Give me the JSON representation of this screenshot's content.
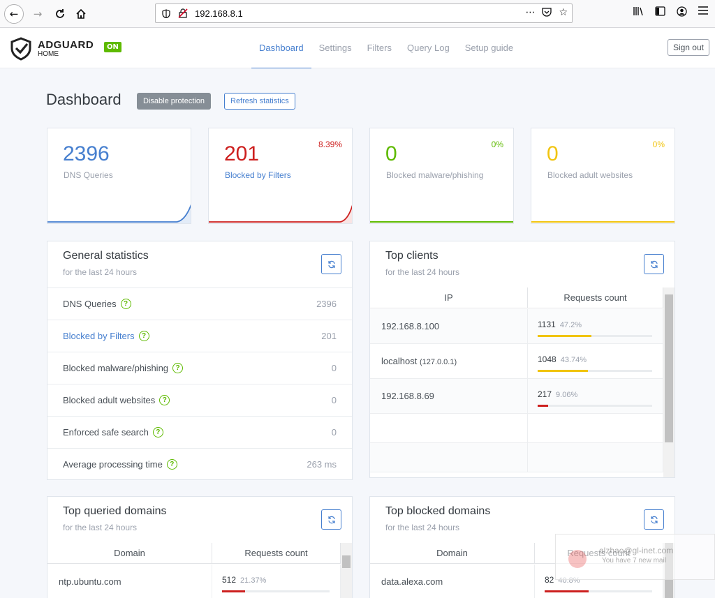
{
  "browser": {
    "url": "192.168.8.1",
    "more_icon": "⋯"
  },
  "app": {
    "logo_name": "ADGUARD",
    "logo_sub": "HOME",
    "status_badge": "ON",
    "tabs": [
      {
        "label": "Dashboard",
        "active": true
      },
      {
        "label": "Settings",
        "active": false
      },
      {
        "label": "Filters",
        "active": false
      },
      {
        "label": "Query Log",
        "active": false
      },
      {
        "label": "Setup guide",
        "active": false
      }
    ],
    "signout_label": "Sign out"
  },
  "dashboard": {
    "title": "Dashboard",
    "disable_label": "Disable protection",
    "refresh_label": "Refresh statistics"
  },
  "stat_cards": [
    {
      "value": "2396",
      "label": "DNS Queries",
      "percent": "",
      "color": "#467fcf"
    },
    {
      "value": "201",
      "label": "Blocked by Filters",
      "percent": "8.39%",
      "color": "#cd201f"
    },
    {
      "value": "0",
      "label": "Blocked malware/phishing",
      "percent": "0%",
      "color": "#5eba00"
    },
    {
      "value": "0",
      "label": "Blocked adult websites",
      "percent": "0%",
      "color": "#f1c40f"
    }
  ],
  "general_stats": {
    "title": "General statistics",
    "subtitle": "for the last 24 hours",
    "rows": [
      {
        "label": "DNS Queries",
        "value": "2396"
      },
      {
        "label": "Blocked by Filters",
        "value": "201"
      },
      {
        "label": "Blocked malware/phishing",
        "value": "0"
      },
      {
        "label": "Blocked adult websites",
        "value": "0"
      },
      {
        "label": "Enforced safe search",
        "value": "0"
      },
      {
        "label": "Average processing time",
        "value": "263 ms"
      }
    ]
  },
  "top_clients": {
    "title": "Top clients",
    "subtitle": "for the last 24 hours",
    "col_ip": "IP",
    "col_count": "Requests count",
    "rows": [
      {
        "ip": "192.168.8.100",
        "ip_sub": "",
        "count": "1131",
        "percent": "47.2%",
        "fill": 0.472,
        "color": "#f1c40f"
      },
      {
        "ip": "localhost",
        "ip_sub": "(127.0.0.1)",
        "count": "1048",
        "percent": "43.74%",
        "fill": 0.4374,
        "color": "#f1c40f"
      },
      {
        "ip": "192.168.8.69",
        "ip_sub": "",
        "count": "217",
        "percent": "9.06%",
        "fill": 0.0906,
        "color": "#cd201f"
      }
    ]
  },
  "top_queried": {
    "title": "Top queried domains",
    "subtitle": "for the last 24 hours",
    "col_domain": "Domain",
    "col_count": "Requests count",
    "rows": [
      {
        "domain": "ntp.ubuntu.com",
        "count": "512",
        "percent": "21.37%",
        "fill": 0.2137,
        "color": "#cd201f"
      }
    ]
  },
  "top_blocked": {
    "title": "Top blocked domains",
    "subtitle": "for the last 24 hours",
    "col_domain": "Domain",
    "col_count": "Requests count",
    "rows": [
      {
        "domain": "data.alexa.com",
        "count": "82",
        "percent": "40.8%",
        "fill": 0.408,
        "color": "#cd201f"
      }
    ]
  },
  "notification": {
    "email": "alzhao@gl-inet.com",
    "text": "You have 7 new mail"
  },
  "icons": {
    "refresh": "refresh-icon",
    "help": "help-icon"
  }
}
